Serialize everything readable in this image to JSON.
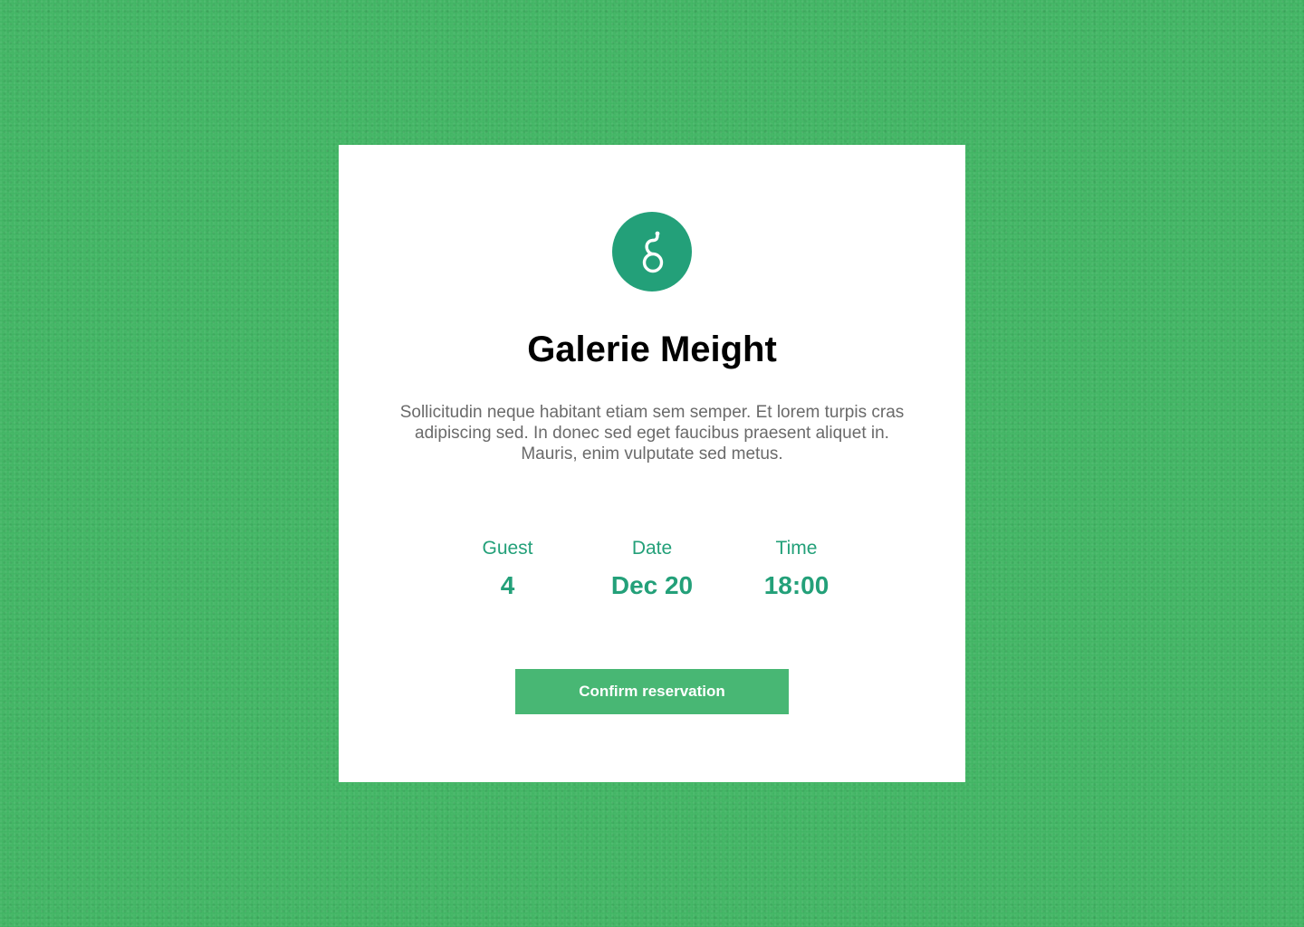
{
  "card": {
    "logo_icon": "g-logo-icon",
    "title": "Galerie Meight",
    "description": "Sollicitudin neque habitant etiam sem semper. Et lorem turpis cras adipiscing sed. In donec sed eget faucibus praesent aliquet in. Mauris, enim vulputate sed metus.",
    "details": [
      {
        "label": "Guest",
        "value": "4"
      },
      {
        "label": "Date",
        "value": "Dec 20"
      },
      {
        "label": "Time",
        "value": "18:00"
      }
    ],
    "confirm_label": "Confirm reservation"
  },
  "colors": {
    "background": "#3fb462",
    "accent": "#23a079",
    "button": "#48b774",
    "card": "#ffffff"
  }
}
